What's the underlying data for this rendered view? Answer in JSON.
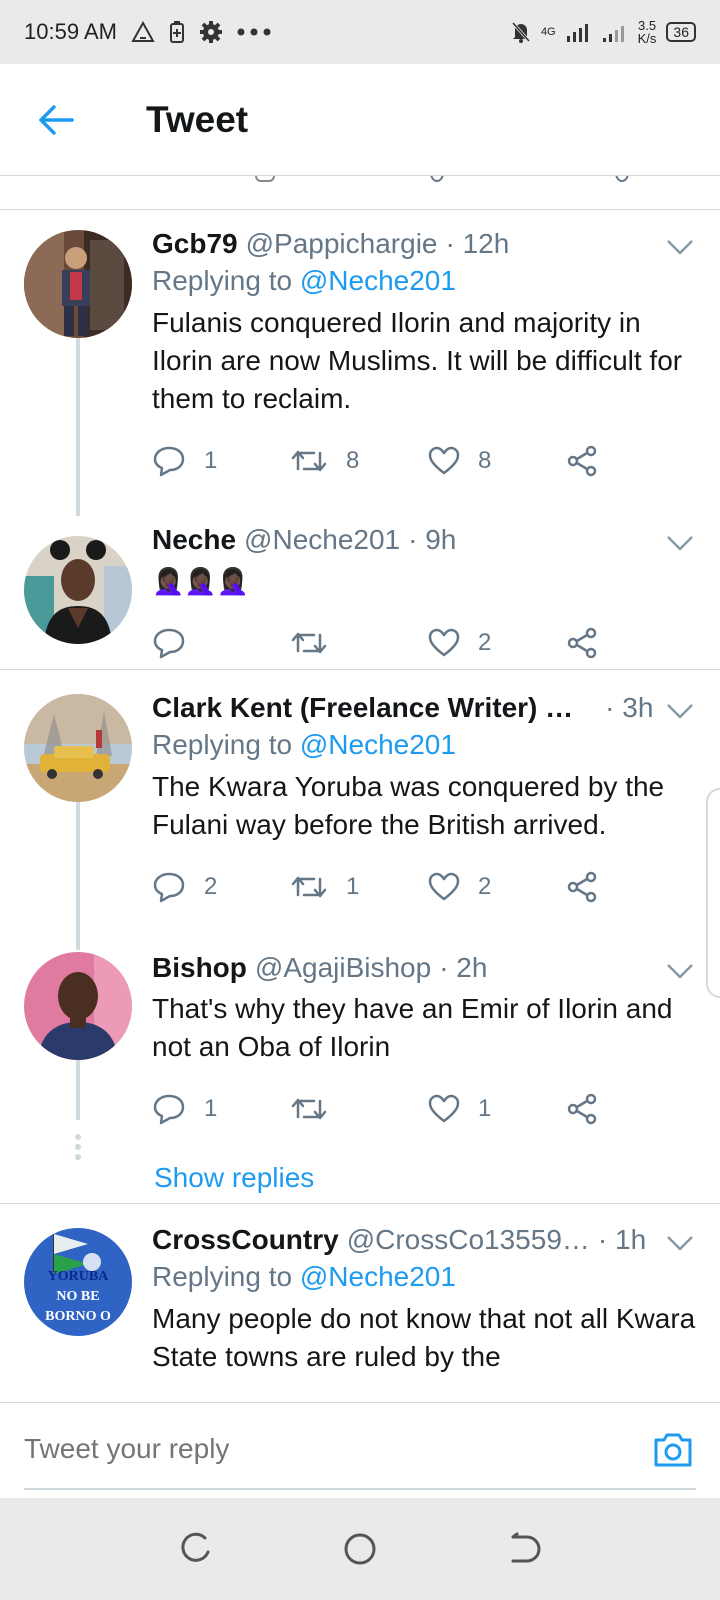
{
  "status_bar": {
    "time": "10:59 AM",
    "network": "4G",
    "speed_value": "3.5",
    "speed_unit": "K/s",
    "battery": "36"
  },
  "header": {
    "title": "Tweet"
  },
  "tweets": [
    {
      "name": "Gcb79",
      "handle": "@Pappichargie",
      "time": "· 12h",
      "reply_prefix": "Replying to",
      "reply_mention": "@Neche201",
      "text": "Fulanis conquered Ilorin and majority in Ilorin are now Muslims. It will be difficult for them to reclaim.",
      "replies": "1",
      "retweets": "8",
      "likes": "8"
    },
    {
      "name": "Neche",
      "handle": "@Neche201",
      "time": "· 9h",
      "text": "🤦🏿‍♀️🤦🏿‍♀️🤦🏿‍♀️",
      "replies": "",
      "retweets": "",
      "likes": "2"
    },
    {
      "name": "Clark Kent (Freelance Writer) …",
      "handle": "",
      "time": "· 3h",
      "reply_prefix": "Replying to",
      "reply_mention": "@Neche201",
      "text": "The Kwara Yoruba was conquered by the Fulani way before the British arrived.",
      "replies": "2",
      "retweets": "1",
      "likes": "2"
    },
    {
      "name": "Bishop",
      "handle": "@AgajiBishop",
      "time": "· 2h",
      "text": "That's why they have an Emir of Ilorin and not an Oba of Ilorin",
      "replies": "1",
      "retweets": "",
      "likes": "1"
    },
    {
      "name": "CrossCountry",
      "handle": "@CrossCo13559…",
      "time": "· 1h",
      "reply_prefix": "Replying to",
      "reply_mention": "@Neche201",
      "text": "Many people do not know that not all Kwara State towns are ruled by the"
    }
  ],
  "show_replies": "Show replies",
  "avatar5_text": {
    "line1": "YORUBA",
    "line2": "NO BE",
    "line3": "BORNO O"
  },
  "composer": {
    "placeholder": "Tweet your reply"
  },
  "colors": {
    "accent": "#1d9bf0",
    "muted": "#657786",
    "divider": "#d7d7d7"
  }
}
